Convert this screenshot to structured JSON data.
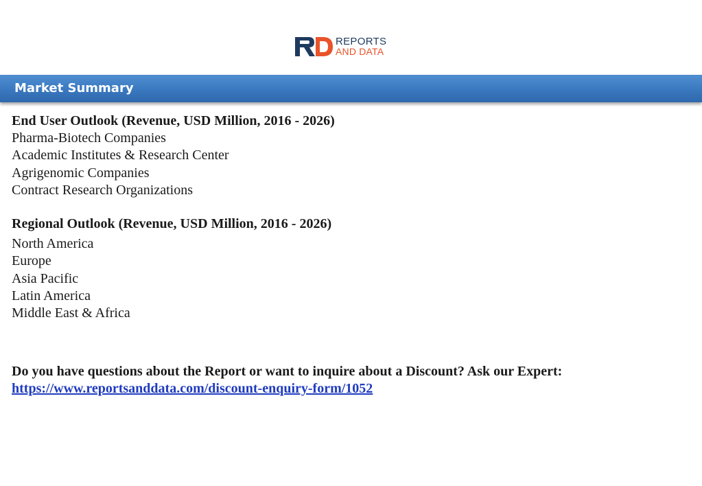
{
  "header": {
    "logo": {
      "line1": "REPORTS",
      "line2": "AND DATA",
      "monogram": "RD",
      "colors": {
        "navy": "#1e3a5f",
        "orange": "#e8532a"
      }
    }
  },
  "banner": {
    "title": "Market Summary",
    "color": "#3a78bf"
  },
  "sections": [
    {
      "heading": "End User Outlook (Revenue, USD Million, 2016 - 2026)",
      "items": [
        "Pharma-Biotech Companies",
        "Academic Institutes & Research Center",
        "Agrigenomic Companies",
        "Contract Research Organizations"
      ]
    },
    {
      "heading": "Regional Outlook (Revenue, USD Million, 2016 - 2026)",
      "items": [
        "North America",
        "Europe",
        "Asia Pacific",
        "Latin America",
        "Middle East & Africa"
      ]
    }
  ],
  "cta": {
    "question": "Do you have questions about the Report or want to inquire about a Discount? Ask our Expert:",
    "link": "https://www.reportsanddata.com/discount-enquiry-form/1052",
    "link_color": "#1f3bbf"
  }
}
